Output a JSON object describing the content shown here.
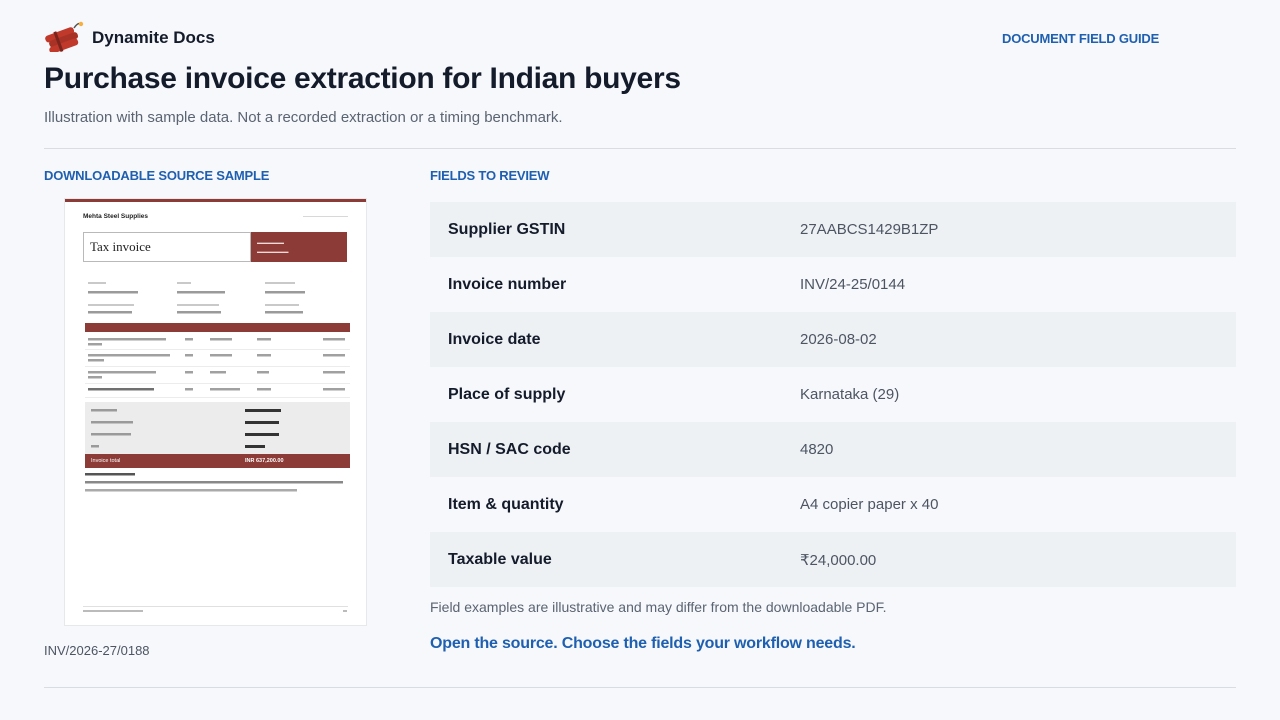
{
  "brand": {
    "name": "Dynamite Docs",
    "logo_icon": "dynamite-icon",
    "logo_color": "#c0392b"
  },
  "header": {
    "guide_link": "DOCUMENT FIELD GUIDE",
    "title": "Purchase invoice extraction for Indian buyers",
    "subtitle": "Illustration with sample data. Not a recorded extraction or a timing benchmark."
  },
  "source": {
    "label": "DOWNLOADABLE SOURCE SAMPLE",
    "document_id": "INV/2026-27/0188",
    "preview": {
      "supplier": "Mehta Steel Supplies",
      "title": "Tax invoice",
      "invoice_total_label": "Invoice total",
      "invoice_total_value": "INR 637,200.00",
      "accent_color": "#8c3b36"
    }
  },
  "fields": {
    "label": "FIELDS TO REVIEW",
    "rows": [
      {
        "name": "Supplier GSTIN",
        "value": "27AABCS1429B1ZP"
      },
      {
        "name": "Invoice number",
        "value": "INV/24-25/0144"
      },
      {
        "name": "Invoice date",
        "value": "2026-08-02"
      },
      {
        "name": "Place of supply",
        "value": "Karnataka (29)"
      },
      {
        "name": "HSN / SAC code",
        "value": "4820"
      },
      {
        "name": "Item & quantity",
        "value": "A4 copier paper x 40"
      },
      {
        "name": "Taxable value",
        "value": "₹24,000.00"
      }
    ],
    "note": "Field examples are illustrative and may differ from the downloadable PDF.",
    "cta": "Open the source. Choose the fields your workflow needs."
  },
  "colors": {
    "accent": "#1f5fb0",
    "heading": "#141b2b",
    "row_shade": "#edf1f4"
  }
}
